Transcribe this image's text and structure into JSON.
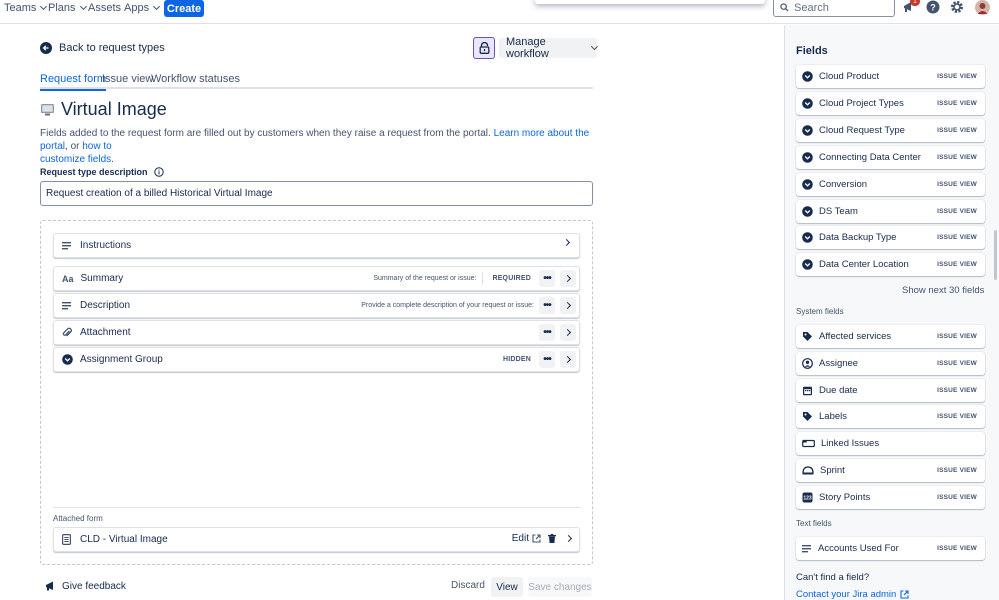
{
  "topnav": {
    "items": [
      "Teams",
      "Plans",
      "Assets",
      "Apps"
    ],
    "create": "Create",
    "search_placeholder": "Search",
    "notifications_count": "1"
  },
  "header": {
    "back": "Back to request types",
    "manage_workflow": "Manage workflow"
  },
  "tabs": [
    "Request form",
    "Issue view",
    "Workflow statuses"
  ],
  "page": {
    "title": "Virtual Image",
    "description": "Fields added to the request form are filled out by customers when they raise a request from the portal.",
    "link1": "Learn more about the portal",
    "or": ", or",
    "link2a": "how to",
    "link2b": "customize fields",
    "period": ".",
    "rtd_label": "Request type description",
    "rtd_value": "Request creation of a billed Historical Virtual Image"
  },
  "form_rows": [
    {
      "label": "Instructions",
      "icon": "lines-icon",
      "hint": "",
      "badge": ""
    },
    {
      "label": "Summary",
      "icon": "text-aa-icon",
      "hint": "Summary of the request or issue:",
      "badge": "REQUIRED"
    },
    {
      "label": "Description",
      "icon": "lines-icon",
      "hint": "Provide a complete description of your request or issue:",
      "badge": ""
    },
    {
      "label": "Attachment",
      "icon": "paperclip-icon",
      "hint": "",
      "badge": ""
    },
    {
      "label": "Assignment Group",
      "icon": "dropdown-icon",
      "hint": "",
      "badge": "HIDDEN"
    }
  ],
  "attached": {
    "label": "Attached form",
    "form_name": "CLD - Virtual Image",
    "edit": "Edit"
  },
  "footer": {
    "feedback": "Give feedback",
    "discard": "Discard",
    "view": "View",
    "save": "Save changes"
  },
  "fields_panel": {
    "title": "Fields",
    "custom_fields": [
      "Cloud Product",
      "Cloud Project Types",
      "Cloud Request Type",
      "Connecting Data Center",
      "Conversion",
      "DS Team",
      "Data Backup Type",
      "Data Center Location"
    ],
    "issue_view": "ISSUE VIEW",
    "show_next": "Show next 30 fields",
    "system_label": "System fields",
    "system_fields": [
      {
        "label": "Affected services",
        "icon": "tag-icon",
        "issue_view": true
      },
      {
        "label": "Assignee",
        "icon": "user-icon",
        "issue_view": true
      },
      {
        "label": "Due date",
        "icon": "calendar-icon",
        "issue_view": true
      },
      {
        "label": "Labels",
        "icon": "tag-icon",
        "issue_view": true
      },
      {
        "label": "Linked Issues",
        "icon": "link-icon",
        "issue_view": false
      },
      {
        "label": "Sprint",
        "icon": "sprint-icon",
        "issue_view": true
      },
      {
        "label": "Story Points",
        "icon": "points-icon",
        "issue_view": true
      }
    ],
    "text_label": "Text fields",
    "text_fields": [
      {
        "label": "Accounts Used For",
        "issue_view": true
      }
    ],
    "cant_find": "Can't find a field?",
    "contact": "Contact your Jira admin"
  },
  "colors": {
    "brand": "#0c66e4",
    "text": "#172b4d",
    "subtle": "#44546f"
  }
}
